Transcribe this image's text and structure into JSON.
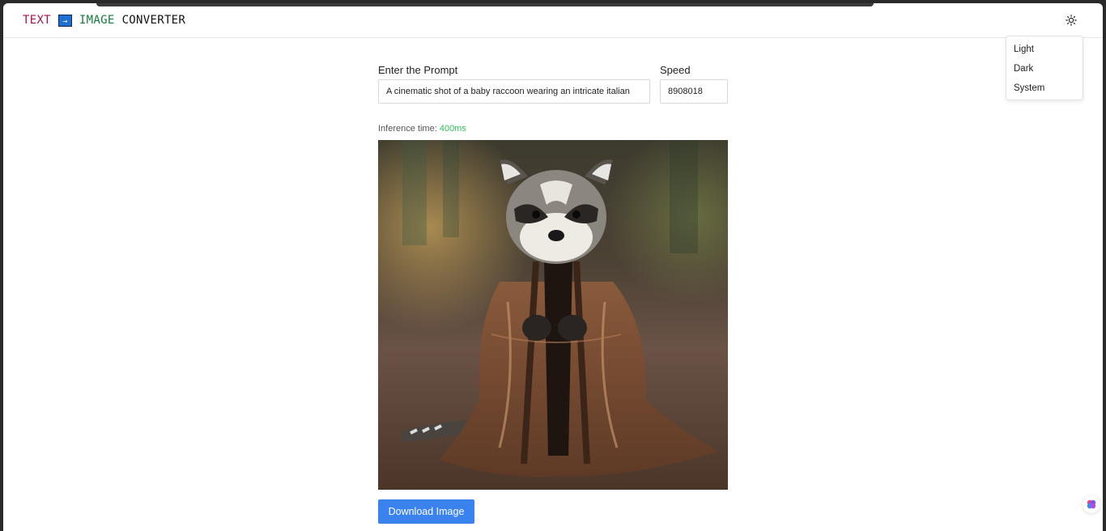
{
  "header": {
    "brand_text": "TEXT",
    "brand_arrow": "→",
    "brand_image": "IMAGE",
    "brand_converter": "CONVERTER",
    "theme_icon": "sun-icon"
  },
  "theme_menu": {
    "items": [
      "Light",
      "Dark",
      "System"
    ]
  },
  "form": {
    "prompt_label": "Enter the Prompt",
    "prompt_value": "A cinematic shot of a baby raccoon wearing an intricate italian",
    "speed_label": "Speed",
    "speed_value": "8908018"
  },
  "result": {
    "inference_label": "Inference time:",
    "inference_value": "400ms",
    "image_subject": "baby raccoon wearing an ornate brown robe",
    "download_label": "Download Image"
  },
  "colors": {
    "brand_text": "#a0144a",
    "brand_image": "#157a3c",
    "brand_arrow_bg": "#1f6fd1",
    "accent_button": "#3a82ee",
    "inference_value": "#2fbf5a"
  }
}
